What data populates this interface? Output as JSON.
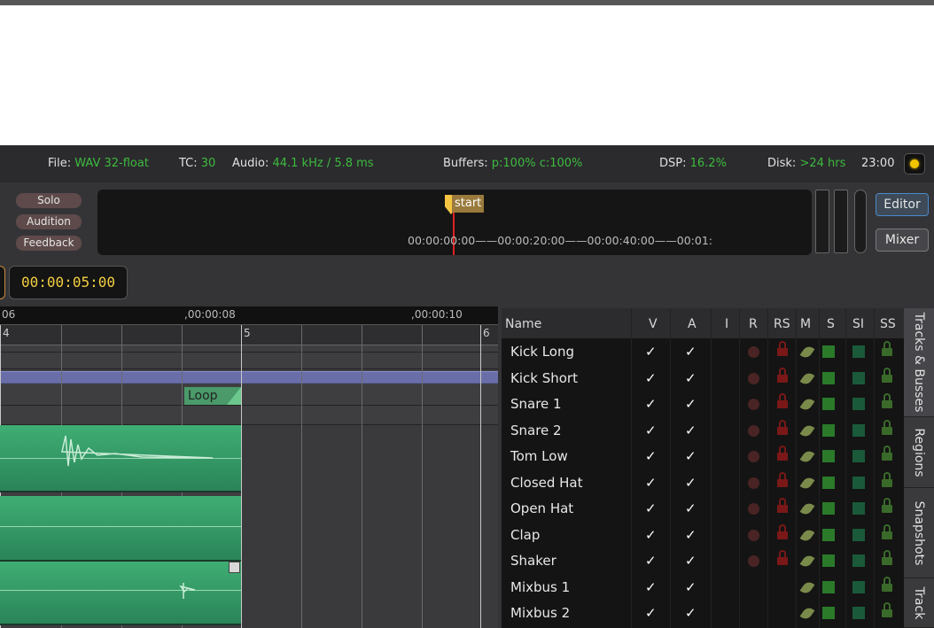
{
  "status": {
    "file_label": "File:",
    "file_value": "WAV 32-float",
    "tc_label": "TC:",
    "tc_value": "30",
    "audio_label": "Audio:",
    "audio_value": "44.1 kHz / 5.8 ms",
    "buffers_label": "Buffers:",
    "buffers_value": "p:100% c:100%",
    "dsp_label": "DSP:",
    "dsp_value": "16.2%",
    "disk_label": "Disk:",
    "disk_value": ">24 hrs",
    "time": "23:00",
    "record_color": "#f2c400"
  },
  "transport": {
    "solo": "Solo",
    "audition": "Audition",
    "feedback": "Feedback"
  },
  "mini_timeline": {
    "marker_label": "start",
    "timecodes": "00:00:00:00——00:00:20:00——00:00:40:00——00:01:"
  },
  "window_buttons": {
    "editor": "Editor",
    "mixer": "Mixer"
  },
  "clock": {
    "value": "00:00:05:00"
  },
  "ruler": {
    "tc_left": "06",
    "tc_mid": "00:00:08",
    "tc_right": "00:00:10",
    "bars": [
      "4",
      "5",
      "6"
    ]
  },
  "loop": {
    "label": "Loop"
  },
  "tracks_panel": {
    "columns": [
      "Name",
      "V",
      "A",
      "I",
      "R",
      "RS",
      "M",
      "S",
      "SI",
      "SS"
    ],
    "check": "✓",
    "rows": [
      {
        "name": "Kick Long",
        "type": "track"
      },
      {
        "name": "Kick Short",
        "type": "track"
      },
      {
        "name": "Snare 1",
        "type": "track"
      },
      {
        "name": "Snare 2",
        "type": "track"
      },
      {
        "name": "Tom Low",
        "type": "track"
      },
      {
        "name": "Closed Hat",
        "type": "track"
      },
      {
        "name": "Open Hat",
        "type": "track"
      },
      {
        "name": "Clap",
        "type": "track"
      },
      {
        "name": "Shaker",
        "type": "track"
      },
      {
        "name": "Mixbus 1",
        "type": "bus"
      },
      {
        "name": "Mixbus 2",
        "type": "bus"
      }
    ]
  },
  "side_tabs": [
    "Tracks & Busses",
    "Regions",
    "Snapshots",
    "Track"
  ]
}
